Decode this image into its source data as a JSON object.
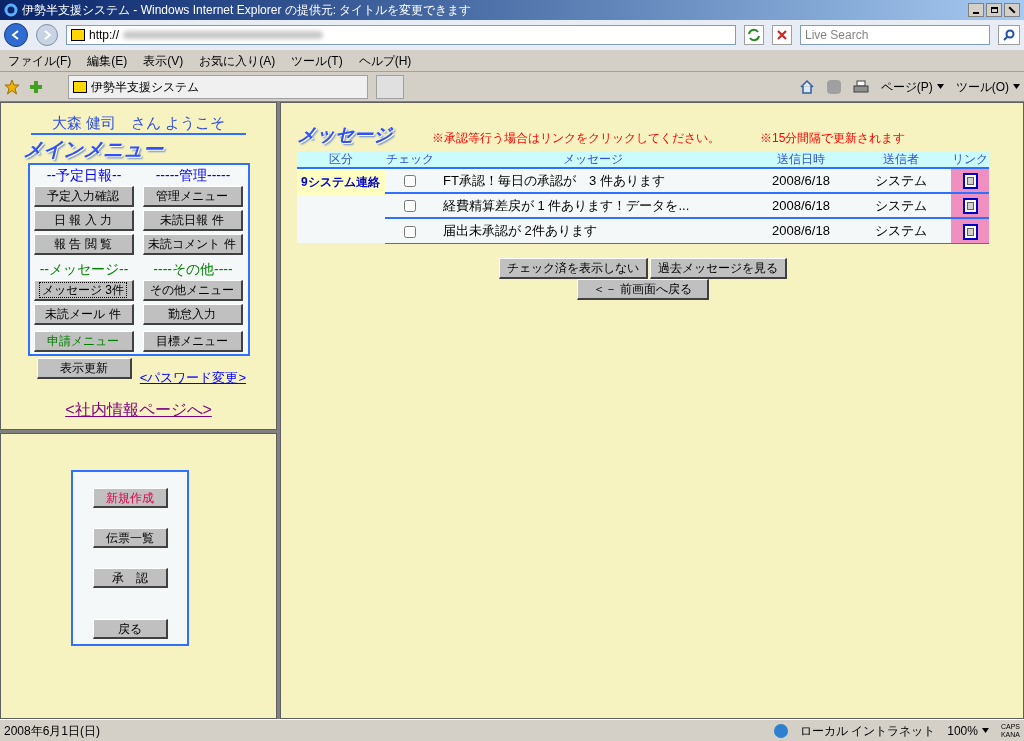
{
  "window": {
    "title": "伊勢半支援システム - Windows Internet Explorer の提供元: タイトルを変更できます"
  },
  "address": {
    "value": "http://"
  },
  "search": {
    "placeholder": "Live Search"
  },
  "menu": [
    "ファイル(F)",
    "編集(E)",
    "表示(V)",
    "お気に入り(A)",
    "ツール(T)",
    "ヘルプ(H)"
  ],
  "tab": {
    "label": "伊勢半支援システム"
  },
  "commands": [
    "ページ(P)",
    "ツール(O)"
  ],
  "left": {
    "welcome": "大森 健司　さん ようこそ",
    "menu_title": "メインメニュー",
    "sections": [
      {
        "title": "--予定日報--",
        "color": "#0000ff",
        "buttons": [
          {
            "label": "予定入力確認",
            "kind": "plain",
            "focused": false
          },
          {
            "label": "日 報 入 力",
            "kind": "plain",
            "focused": false
          },
          {
            "label": "報 告 閲 覧",
            "kind": "plain",
            "focused": false
          }
        ]
      },
      {
        "title": "-----管理-----",
        "color": "#0000ff",
        "buttons": [
          {
            "label": "管理メニュー",
            "kind": "plain",
            "focused": false
          },
          {
            "label": "未読日報 件",
            "kind": "plain",
            "focused": false
          },
          {
            "label": "未読コメント 件",
            "kind": "plain",
            "focused": false
          }
        ]
      },
      {
        "title": "--メッセージ--",
        "color": "#008000",
        "buttons": [
          {
            "label": "メッセージ 3件",
            "kind": "plain",
            "focused": true
          },
          {
            "label": "未読メール 件",
            "kind": "plain",
            "focused": false
          },
          {
            "label": "申請メニュー",
            "kind": "accent",
            "focused": false
          }
        ]
      },
      {
        "title": "----その他----",
        "color": "#008000",
        "buttons": [
          {
            "label": "その他メニュー",
            "kind": "plain",
            "focused": false
          },
          {
            "label": "勤怠入力",
            "kind": "plain",
            "focused": false
          },
          {
            "label": "目標メニュー",
            "kind": "plain",
            "focused": false
          }
        ]
      }
    ],
    "refresh": "表示更新",
    "password_link": "<パスワード変更>",
    "info_link": "<社内情報ページへ>"
  },
  "lower_left": {
    "buttons": [
      {
        "label": "新規作成",
        "kind": "accent"
      },
      {
        "label": "伝票一覧",
        "kind": "plain"
      },
      {
        "label": "承　認",
        "kind": "plain"
      },
      {
        "label": "戻る",
        "kind": "plain"
      }
    ]
  },
  "main": {
    "title": "メッセージ",
    "notes": [
      "※承認等行う場合はリンクをクリックしてください。",
      "※15分間隔で更新されます"
    ],
    "columns": [
      "区分",
      "チェック",
      "メッセージ",
      "送信日時",
      "送信者",
      "リンク"
    ],
    "category": "9システム連絡",
    "rows": [
      {
        "checked": false,
        "message": "FT承認！毎日の承認が　3 件あります",
        "date": "2008/6/18",
        "sender": "システム"
      },
      {
        "checked": false,
        "message": "経費精算差戻が 1 件あります！データを...",
        "date": "2008/6/18",
        "sender": "システム"
      },
      {
        "checked": false,
        "message": "届出未承認が 2件あります",
        "date": "2008/6/18",
        "sender": "システム"
      }
    ],
    "buttons": [
      "チェック済を表示しない",
      "過去メッセージを見る"
    ],
    "back": "＜－ 前画面へ戻る"
  },
  "status_bar": {
    "text": "2008年6月1日(日)",
    "zone": "ローカル イントラネット",
    "zoom": "100%",
    "ime": [
      "CAPS",
      "KANA"
    ]
  }
}
